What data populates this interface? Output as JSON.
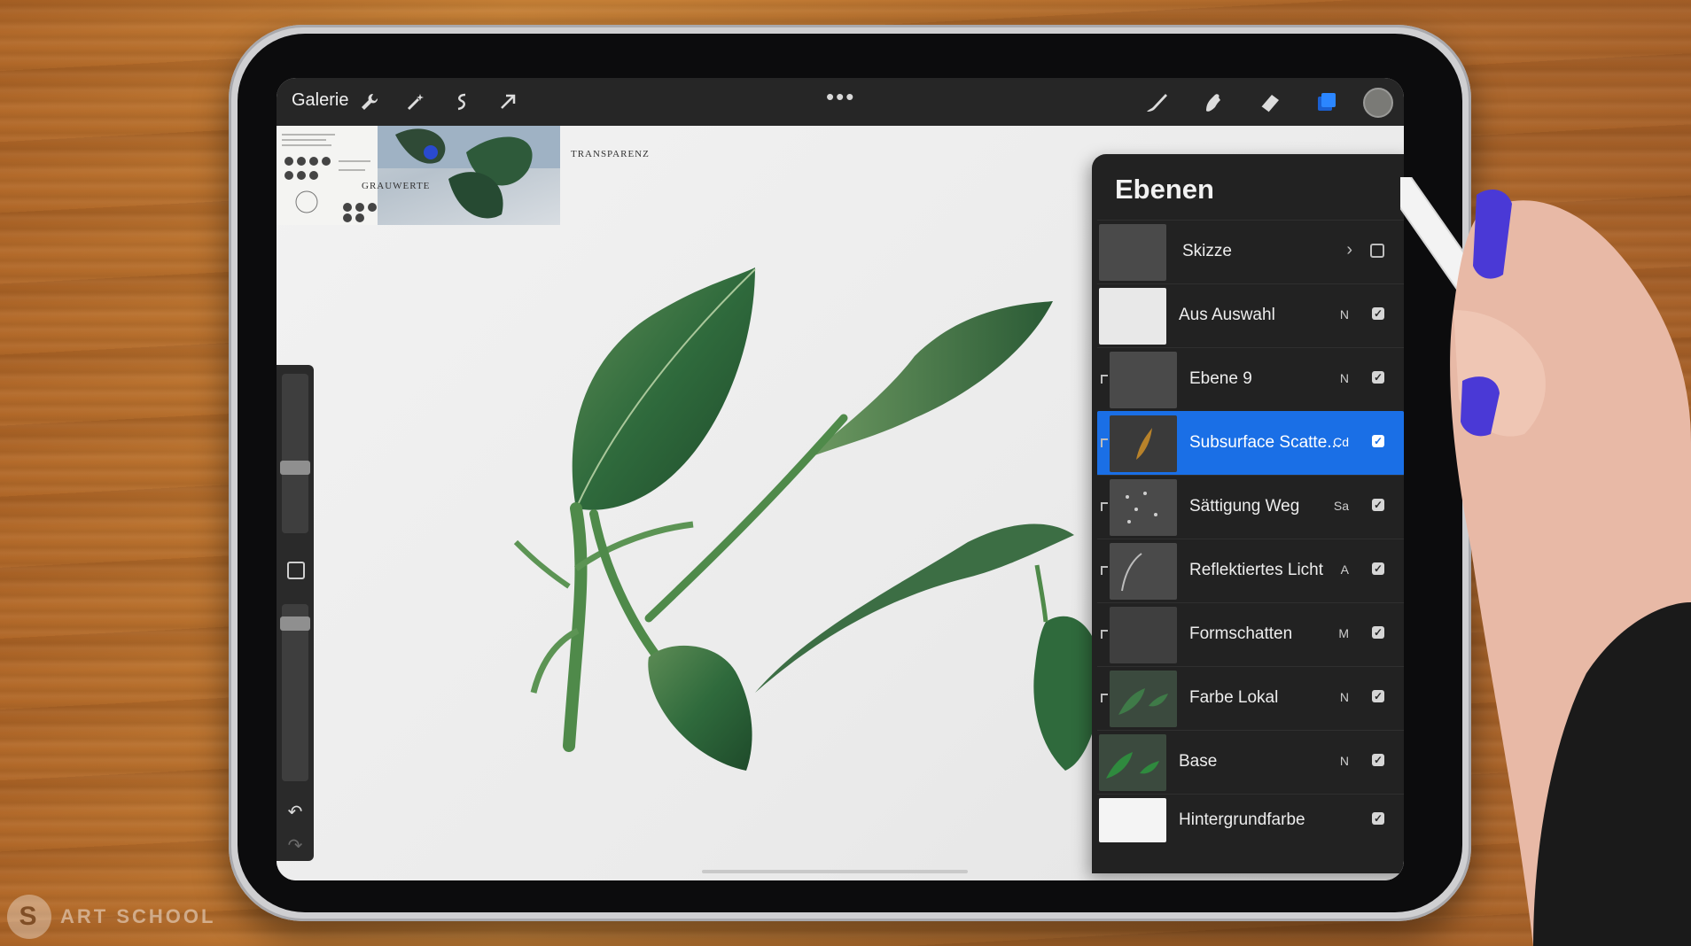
{
  "toolbar": {
    "gallery_label": "Galerie",
    "left_tools": [
      "wrench-icon",
      "magic-wand-icon",
      "selection-icon",
      "transform-arrow-icon"
    ],
    "more_label": "•••",
    "right_tools": [
      "brush-icon",
      "smudge-icon",
      "eraser-icon",
      "layers-icon"
    ],
    "active_color": "#7a7a76",
    "accent": "#1a6fe6"
  },
  "layers_panel": {
    "title": "Ebenen",
    "layers": [
      {
        "name": "Skizze",
        "mode": "",
        "visible": false,
        "group": true,
        "clipped": false,
        "active": false
      },
      {
        "name": "Aus Auswahl",
        "mode": "N",
        "visible": true,
        "group": false,
        "clipped": false,
        "active": false
      },
      {
        "name": "Ebene 9",
        "mode": "N",
        "visible": true,
        "group": false,
        "clipped": true,
        "active": false
      },
      {
        "name": "Subsurface Scatte...",
        "mode": "Cd",
        "visible": true,
        "group": false,
        "clipped": true,
        "active": true
      },
      {
        "name": "Sättigung Weg",
        "mode": "Sa",
        "visible": true,
        "group": false,
        "clipped": true,
        "active": false
      },
      {
        "name": "Reflektiertes Licht",
        "mode": "A",
        "visible": true,
        "group": false,
        "clipped": true,
        "active": false
      },
      {
        "name": "Formschatten",
        "mode": "M",
        "visible": true,
        "group": false,
        "clipped": true,
        "active": false
      },
      {
        "name": "Farbe Lokal",
        "mode": "N",
        "visible": true,
        "group": false,
        "clipped": true,
        "active": false
      },
      {
        "name": "Base",
        "mode": "N",
        "visible": true,
        "group": false,
        "clipped": false,
        "active": false
      },
      {
        "name": "Hintergrundfarbe",
        "mode": "",
        "visible": true,
        "group": false,
        "clipped": false,
        "active": false
      }
    ]
  },
  "reference": {
    "heading_1": "GRAUWERTE",
    "heading_2": "TRANSPARENZ"
  },
  "watermark": {
    "text": "ART SCHOOL",
    "badge": "S"
  }
}
